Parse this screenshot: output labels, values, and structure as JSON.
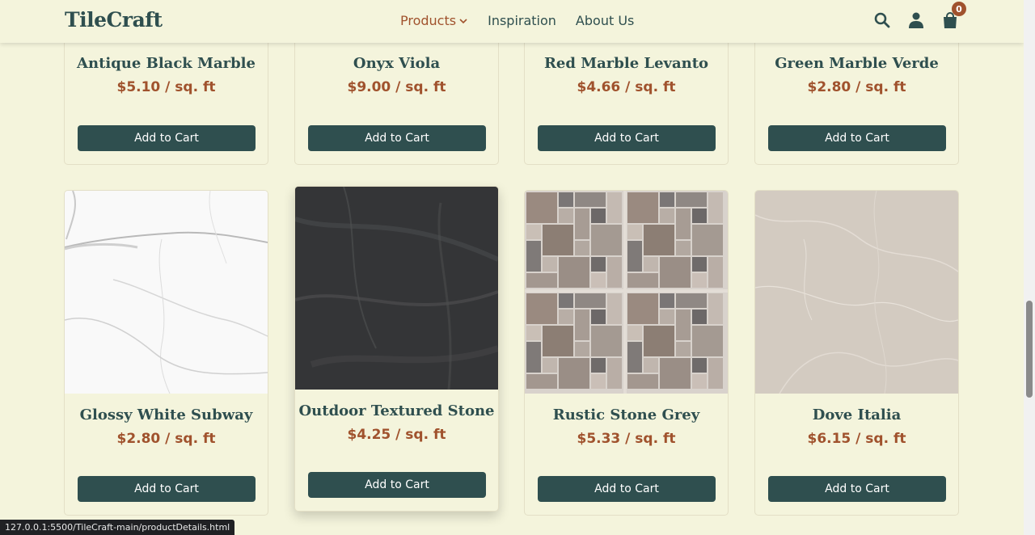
{
  "header": {
    "logo": "TileCraft",
    "nav": [
      {
        "label": "Products"
      },
      {
        "label": "Inspiration"
      },
      {
        "label": "About Us"
      }
    ],
    "cart_count": "0",
    "icons": [
      "search-icon",
      "user-icon",
      "shopping-bag-icon"
    ]
  },
  "products": [
    {
      "name": "Antique Black Marble",
      "price": "$5.10 / sq. ft",
      "button": "Add to Cart"
    },
    {
      "name": "Onyx Viola",
      "price": "$9.00 / sq. ft",
      "button": "Add to Cart"
    },
    {
      "name": "Red Marble Levanto",
      "price": "$4.66 / sq. ft",
      "button": "Add to Cart"
    },
    {
      "name": "Green Marble Verde",
      "price": "$2.80 / sq. ft",
      "button": "Add to Cart"
    },
    {
      "name": "Glossy White Subway",
      "price": "$2.80 / sq. ft",
      "button": "Add to Cart"
    },
    {
      "name": "Outdoor Textured Stone",
      "price": "$4.25 / sq. ft",
      "button": "Add to Cart"
    },
    {
      "name": "Rustic Stone Grey",
      "price": "$5.33 / sq. ft",
      "button": "Add to Cart"
    },
    {
      "name": "Dove Italia",
      "price": "$6.15 / sq. ft",
      "button": "Add to Cart"
    }
  ],
  "colors": {
    "background": "#f4f4dc",
    "primary": "#2f4f4f",
    "accent": "#a0522d"
  },
  "status_url": "127.0.0.1:5500/TileCraft-main/productDetails.html"
}
